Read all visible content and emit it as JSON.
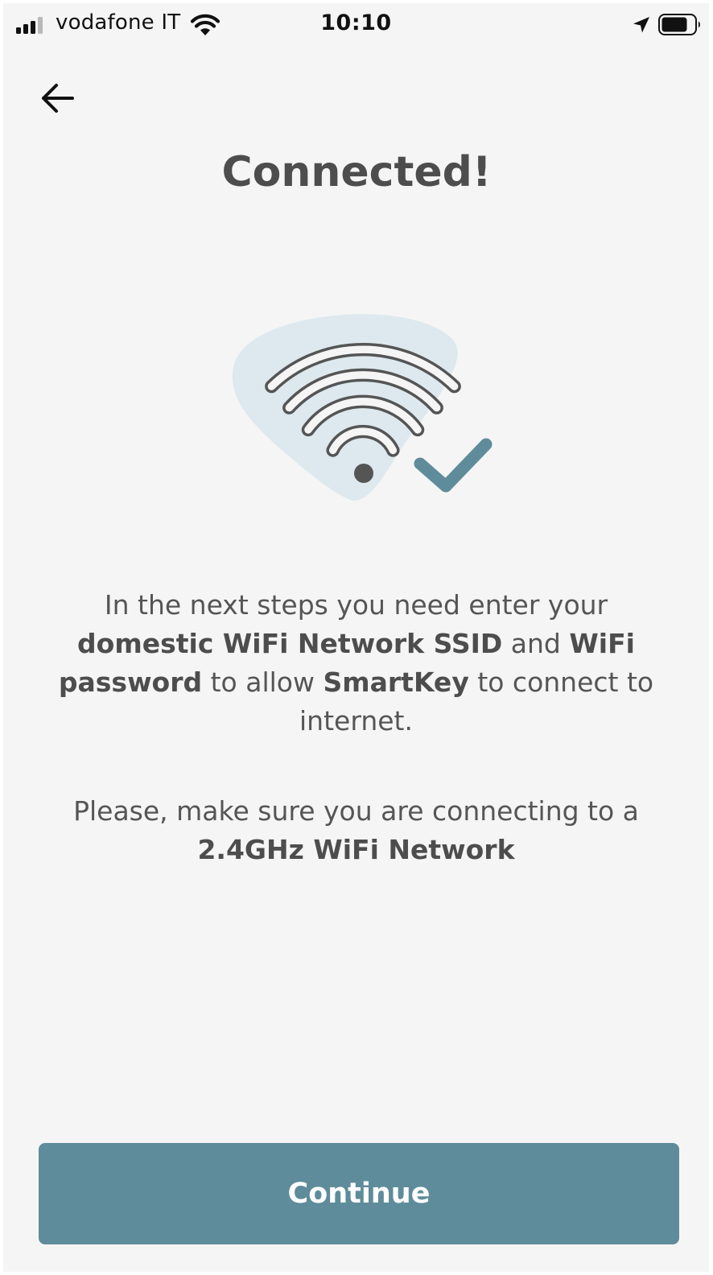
{
  "status_bar": {
    "carrier": "vodafone IT",
    "time": "10:10",
    "icons": [
      "signal-icon",
      "wifi-icon",
      "location-arrow-icon",
      "battery-icon"
    ]
  },
  "header": {
    "back_icon": "arrow-left-icon",
    "title": "Connected!"
  },
  "illustration": {
    "icons": [
      "wifi-icon",
      "checkmark-icon"
    ],
    "colors": {
      "blob": "#dde9ee",
      "wifi_stroke": "#555555",
      "checkmark": "#5f8c9a"
    }
  },
  "body": {
    "paragraph1": {
      "t1": "In the next steps you need enter your ",
      "b1": "domestic WiFi Network SSID",
      "t2": " and ",
      "b2": "WiFi password",
      "t3": " to allow ",
      "b3": "SmartKey",
      "t4": " to connect to internet."
    },
    "paragraph2": {
      "t1": "Please, make sure you are connecting to a ",
      "b1": "2.4GHz WiFi Network"
    }
  },
  "footer": {
    "continue_label": "Continue"
  },
  "colors": {
    "background": "#f5f5f5",
    "accent": "#5f8c9a",
    "text": "#555555"
  }
}
